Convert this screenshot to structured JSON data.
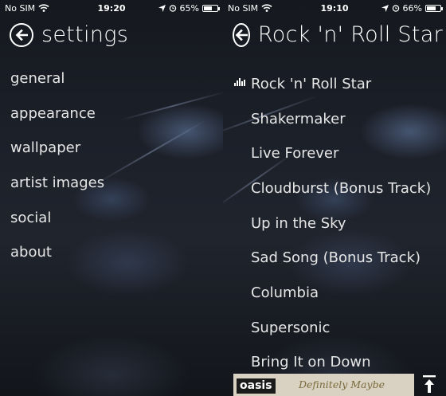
{
  "left_screen": {
    "status": {
      "carrier": "No SIM",
      "time": "19:20",
      "battery_percent": "65%",
      "battery_level": 0.65
    },
    "title": "settings",
    "menu": [
      "general",
      "appearance",
      "wallpaper",
      "artist images",
      "social",
      "about"
    ]
  },
  "right_screen": {
    "status": {
      "carrier": "No SIM",
      "time": "19:10",
      "battery_percent": "66%",
      "battery_level": 0.66
    },
    "title": "Rock 'n' Roll Star",
    "tracks": [
      "Rock 'n' Roll Star",
      "Shakermaker",
      "Live Forever",
      "Cloudburst (Bonus Track)",
      "Up in the Sky",
      "Sad Song (Bonus Track)",
      "Columbia",
      "Supersonic",
      "Bring It on Down"
    ],
    "now_playing_index": 0,
    "album_art": {
      "logo": "oasis",
      "script": "Definitely Maybe"
    }
  },
  "icons": {
    "back": "back-arrow-circle-icon",
    "wifi": "wifi-icon",
    "location": "location-arrow-icon",
    "alarm": "alarm-clock-icon",
    "battery": "battery-icon",
    "now_playing": "equalizer-bars-icon",
    "scroll_top": "scroll-to-top-icon"
  }
}
